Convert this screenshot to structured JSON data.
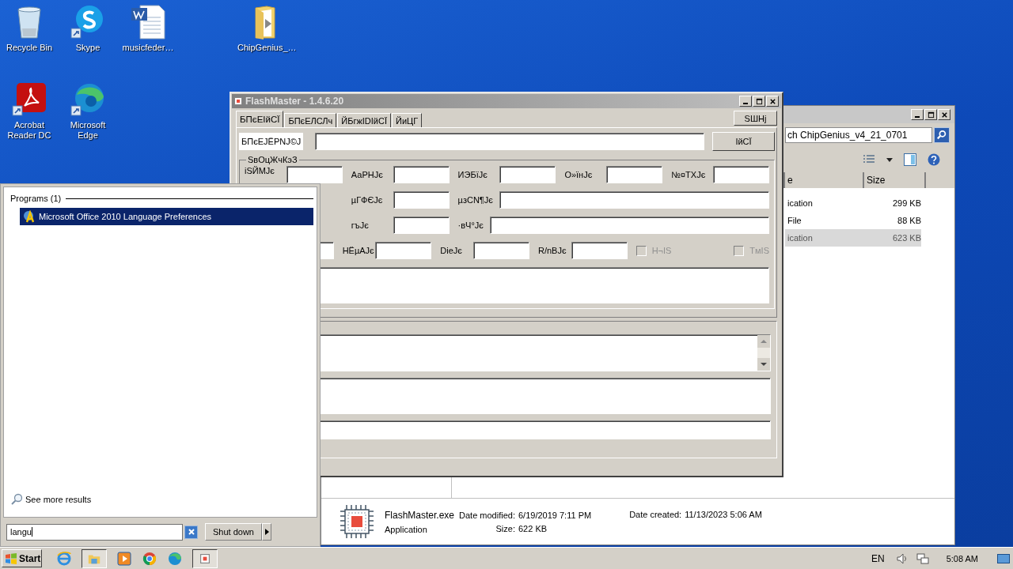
{
  "desktop_icons": [
    {
      "label": "Recycle Bin"
    },
    {
      "label": "Skype"
    },
    {
      "label": "musicfeder…"
    },
    {
      "label": "ChipGenius_…"
    },
    {
      "label": "Acrobat Reader DC"
    },
    {
      "label": "Microsoft Edge"
    }
  ],
  "explorer": {
    "search": {
      "value": "ch ChipGenius_v4_21_0701"
    },
    "columns": [
      "e",
      "Size"
    ],
    "rows": [
      {
        "type": "ication",
        "size": "299 KB",
        "selected": false
      },
      {
        "type": "File",
        "size": "88 KB",
        "selected": false
      },
      {
        "type": "ication",
        "size": "623 KB",
        "selected": true
      }
    ],
    "details": {
      "name": "FlashMaster.exe",
      "type": "Application",
      "modified_label": "Date modified:",
      "modified": "6/19/2019 7:11 PM",
      "created_label": "Date created:",
      "created": "11/13/2023 5:06 AM",
      "size_label": "Size:",
      "size": "622 KB"
    }
  },
  "flashmaster": {
    "title": "FlashMaster - 1.4.6.20",
    "tabs": [
      {
        "label": "БПєЕІйСЇ",
        "selected": true
      },
      {
        "label": "БПєЕЛСЛч",
        "selected": false
      },
      {
        "label": "ЙБгжІDІйСЇ",
        "selected": false
      },
      {
        "label": "ЙиЦГ",
        "selected": false
      }
    ],
    "side_button": "SШНј",
    "query_label": "БПєЕЈЁРNЈ©Ј",
    "query_button": "ІйСЇ",
    "group_title": "SвОцЖчКэЗ",
    "rows": [
      [
        {
          "kind": "field",
          "label": "іЅЙМЈє"
        },
        {
          "kind": "field",
          "label": "АаРНЈє"
        },
        {
          "kind": "field",
          "label": "ИЭБїЈє"
        },
        {
          "kind": "field",
          "label": "О»їнЈє"
        },
        {
          "kind": "field",
          "label": "№¤ТХЈє"
        }
      ],
      [
        {
          "kind": "field",
          "label": "µГФЄЈє"
        },
        {
          "kind": "wide",
          "label": "µзСN¶Јє"
        }
      ],
      [
        {
          "kind": "field",
          "label": "гъЈє"
        },
        {
          "kind": "wide",
          "label": "·вЧ°Јє"
        }
      ],
      [
        {
          "kind": "field"
        },
        {
          "kind": "field",
          "label": "НЁµАЈє"
        },
        {
          "kind": "field",
          "label": "DieЈє"
        },
        {
          "kind": "field",
          "label": "R/nBЈє"
        },
        {
          "kind": "checkbox",
          "label": "H¬IS",
          "checked": false,
          "disabled": true
        },
        {
          "kind": "checkbox",
          "label": "TмIS",
          "checked": false,
          "disabled": true
        }
      ]
    ]
  },
  "start_menu": {
    "section": "Programs (1)",
    "results": [
      {
        "label": "Microsoft Office 2010 Language Preferences",
        "selected": true
      }
    ],
    "more": "See more results",
    "search": {
      "value": "langu"
    },
    "shutdown": "Shut down"
  },
  "taskbar": {
    "start": "Start",
    "language": "EN",
    "time": "5:08 AM"
  }
}
